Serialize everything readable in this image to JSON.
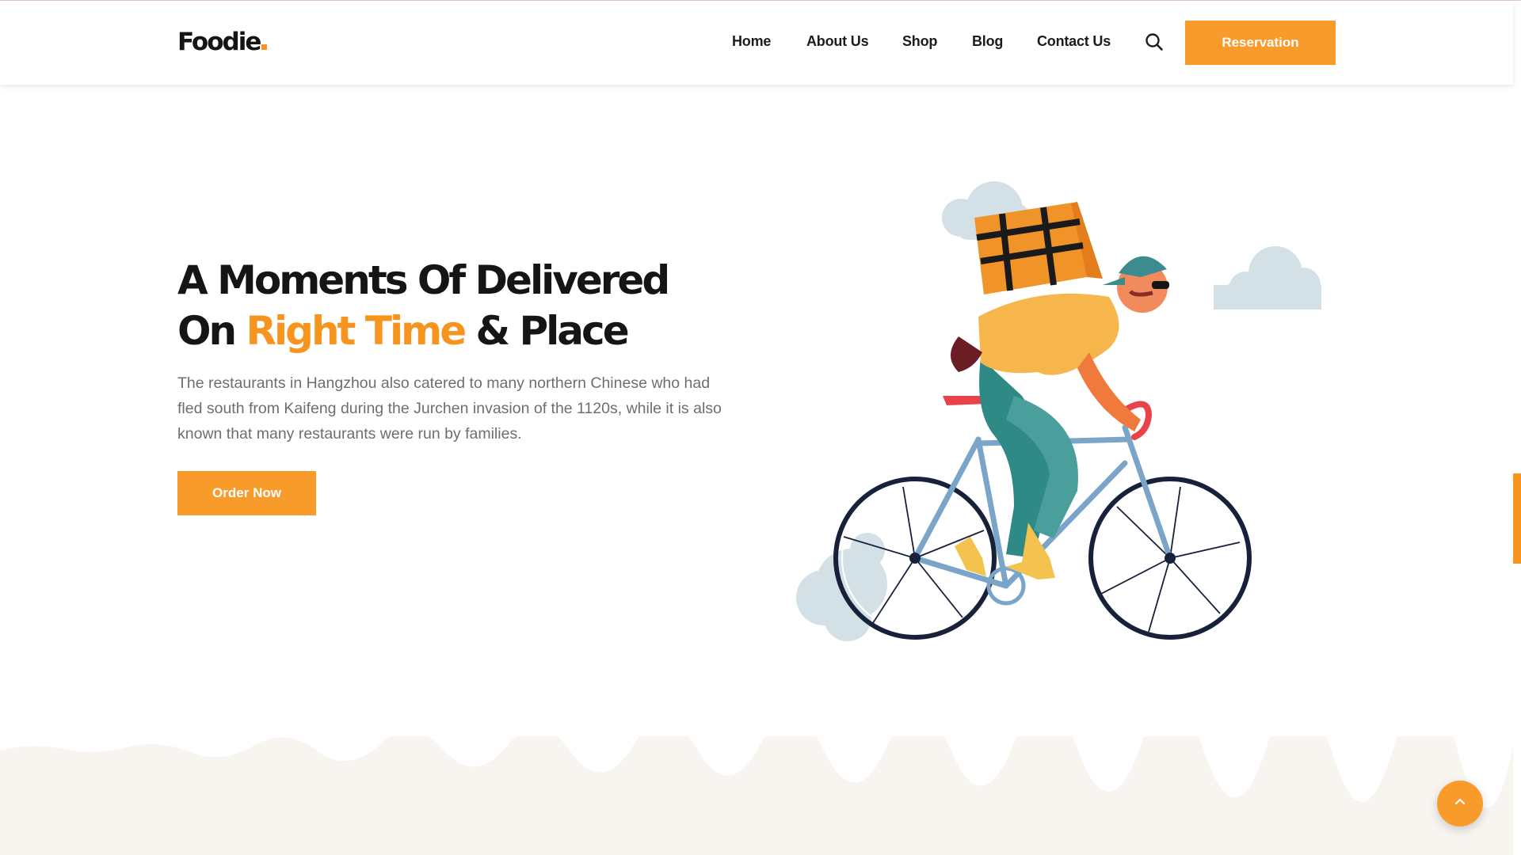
{
  "header": {
    "logo": "Foodie",
    "nav": [
      "Home",
      "About Us",
      "Shop",
      "Blog",
      "Contact Us"
    ],
    "search_icon": "search-icon",
    "reservation_label": "Reservation"
  },
  "hero": {
    "title_line1": "A Moments Of Delivered",
    "title_line2_start": "On ",
    "title_line2_accent": "Right Time",
    "title_line2_end": " & Place",
    "description": "The restaurants in Hangzhou also catered to many northern Chinese who had fled south from Kaifeng during the Jurchen invasion of the 1120s, while it is also known that many restaurants were run by families.",
    "order_label": "Order Now",
    "illustration": "delivery-cyclist-illustration"
  },
  "back_to_top_icon": "chevron-up-icon",
  "colors": {
    "accent": "#f99b2b",
    "heading": "#151515",
    "body_text": "#6e6e6e",
    "band": "#f8f5f1"
  }
}
